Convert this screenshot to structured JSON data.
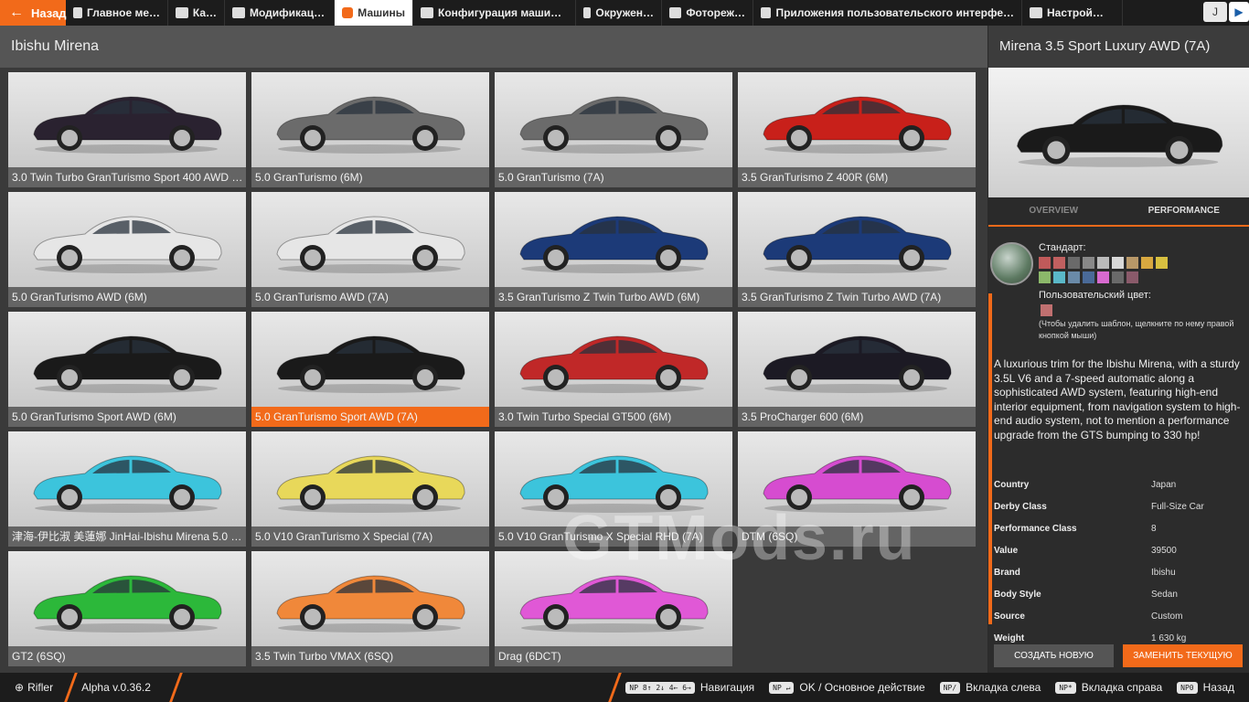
{
  "topbar": {
    "back_label": "Назад",
    "tabs": [
      {
        "label": "Главное ме…",
        "active": false,
        "icon": "grid-icon"
      },
      {
        "label": "Ка…",
        "active": false,
        "icon": "map-icon"
      },
      {
        "label": "Модификац…",
        "active": false,
        "icon": "puzzle-icon"
      },
      {
        "label": "Машины",
        "active": true,
        "icon": "car-icon"
      },
      {
        "label": "Конфигурация маши…",
        "active": false,
        "icon": "engine-icon"
      },
      {
        "label": "Окружен…",
        "active": false,
        "icon": "weather-icon"
      },
      {
        "label": "Фотореж…",
        "active": false,
        "icon": "camera-icon"
      },
      {
        "label": "Приложения пользовательского интерфе…",
        "active": false,
        "icon": "app-icon"
      },
      {
        "label": "Настрой…",
        "active": false,
        "icon": "settings-icon"
      }
    ],
    "right_key": "J"
  },
  "main": {
    "brand": "Ibishu Mirena",
    "cars": [
      {
        "label": "3.0 Twin Turbo GranTurismo Sport 400 AWD (…",
        "color": "#2a2230",
        "selected": false
      },
      {
        "label": "5.0 GranTurismo (6M)",
        "color": "#6b6b6b",
        "selected": false
      },
      {
        "label": "5.0 GranTurismo (7A)",
        "color": "#6b6b6b",
        "selected": false
      },
      {
        "label": "3.5 GranTurismo Z 400R (6M)",
        "color": "#c8201a",
        "selected": false
      },
      {
        "label": "5.0 GranTurismo AWD (6M)",
        "color": "#e6e6e6",
        "selected": false
      },
      {
        "label": "5.0 GranTurismo AWD (7A)",
        "color": "#e6e6e6",
        "selected": false
      },
      {
        "label": "3.5 GranTurismo Z Twin Turbo AWD (6M)",
        "color": "#1c3a78",
        "selected": false
      },
      {
        "label": "3.5 GranTurismo Z Twin Turbo AWD (7A)",
        "color": "#1c3a78",
        "selected": false
      },
      {
        "label": "5.0 GranTurismo Sport AWD (6M)",
        "color": "#1a1a1a",
        "selected": false
      },
      {
        "label": "5.0 GranTurismo Sport AWD (7A)",
        "color": "#1a1a1a",
        "selected": true
      },
      {
        "label": "3.0 Twin Turbo Special GT500 (6M)",
        "color": "#c02828",
        "selected": false
      },
      {
        "label": "3.5 ProCharger 600 (6M)",
        "color": "#1c1a24",
        "selected": false
      },
      {
        "label": "津海-伊比淑 美蓮娜 JinHai-Ibishu Mirena 5.0 G…",
        "color": "#3cc4dc",
        "selected": false
      },
      {
        "label": "5.0 V10 GranTurismo X Special (7A)",
        "color": "#e8d85a",
        "selected": false
      },
      {
        "label": "5.0 V10 GranTurismo X Special RHD (7A)",
        "color": "#3cc4dc",
        "selected": false
      },
      {
        "label": "DTM (6SQ)",
        "color": "#d64cd0",
        "selected": false
      },
      {
        "label": "GT2 (6SQ)",
        "color": "#2cb83a",
        "selected": false
      },
      {
        "label": "3.5 Twin Turbo VMAX (6SQ)",
        "color": "#f0883a",
        "selected": false
      },
      {
        "label": "Drag (6DCT)",
        "color": "#e058d6",
        "selected": false
      }
    ],
    "watermark": "GTMods.ru"
  },
  "side": {
    "title": "Mirena 3.5 Sport Luxury AWD (7A)",
    "preview_color": "#1a1a1a",
    "tab_overview": "OVERVIEW",
    "tab_performance": "PERFORMANCE",
    "std_label": "Стандарт:",
    "swatches": [
      "#c05a5a",
      "#c06060",
      "#6a6a6a",
      "#888888",
      "#bbbbbb",
      "#d8d8d8",
      "#b89868",
      "#d8a840",
      "#d8c040",
      "#8cb86a",
      "#5ab8c8",
      "#6a8aa8",
      "#4a6a98",
      "#d86ad0",
      "#6a6a6a",
      "#8a5a6a"
    ],
    "custom_label": "Пользовательский цвет:",
    "hint": "(Чтобы удалить шаблон, щелкните по нему правой кнопкой мыши)",
    "description": "A luxurious trim for the Ibishu Mirena, with a sturdy 3.5L V6 and a 7-speed automatic along a sophisticated AWD system, featuring high-end interior equipment, from navigation system to high-end audio system, not to mention a performance upgrade from the GTS bumping to 330 hp!",
    "stats": [
      {
        "k": "Country",
        "v": "Japan"
      },
      {
        "k": "Derby Class",
        "v": "Full-Size Car"
      },
      {
        "k": "Performance Class",
        "v": "8"
      },
      {
        "k": "Value",
        "v": "39500"
      },
      {
        "k": "Brand",
        "v": "Ibishu"
      },
      {
        "k": "Body Style",
        "v": "Sedan"
      },
      {
        "k": "Source",
        "v": "Custom"
      },
      {
        "k": "Weight",
        "v": "1 630 kg"
      }
    ],
    "btn_new": "СОЗДАТЬ НОВУЮ",
    "btn_replace": "ЗАМЕНИТЬ ТЕКУЩУЮ"
  },
  "bottombar": {
    "user": "Rifler",
    "version": "Alpha v.0.36.2",
    "nav_key": "NP 8↑ 2↓ 4← 6→",
    "nav_label": "Навигация",
    "ok_key": "NP ↵",
    "ok_label": "OK / Основное действие",
    "left_key": "NP/",
    "left_label": "Вкладка слева",
    "right_key": "NP*",
    "right_label": "Вкладка справа",
    "back_key": "NP0",
    "back_label": "Назад"
  }
}
